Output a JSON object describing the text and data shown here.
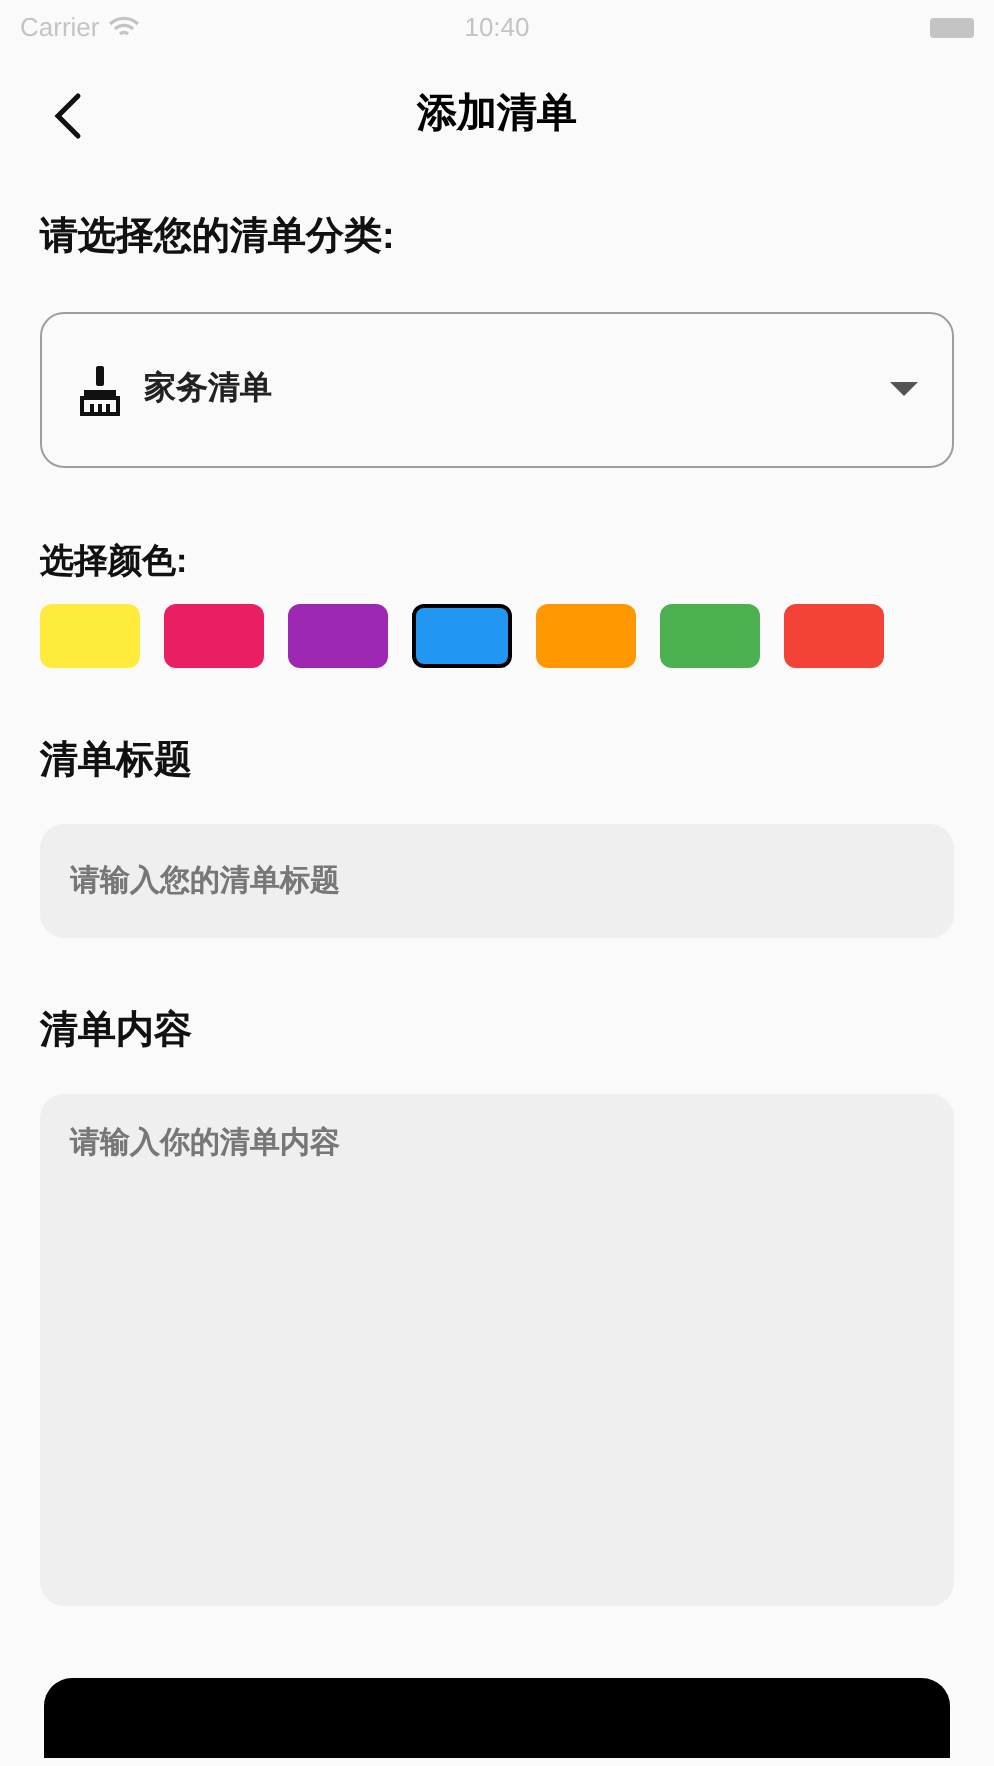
{
  "status_bar": {
    "carrier": "Carrier",
    "time": "10:40"
  },
  "header": {
    "title": "添加清单"
  },
  "category": {
    "label": "请选择您的清单分类:",
    "value": "家务清单"
  },
  "colors": {
    "label": "选择颜色:",
    "swatches": [
      {
        "color": "#ffeb3b",
        "selected": false
      },
      {
        "color": "#e91e63",
        "selected": false
      },
      {
        "color": "#9c27b0",
        "selected": false
      },
      {
        "color": "#2196f3",
        "selected": true
      },
      {
        "color": "#ff9800",
        "selected": false
      },
      {
        "color": "#4caf50",
        "selected": false
      },
      {
        "color": "#f44336",
        "selected": false
      }
    ]
  },
  "title_field": {
    "label": "清单标题",
    "placeholder": "请输入您的清单标题"
  },
  "content_field": {
    "label": "清单内容",
    "placeholder": "请输入你的清单内容"
  }
}
